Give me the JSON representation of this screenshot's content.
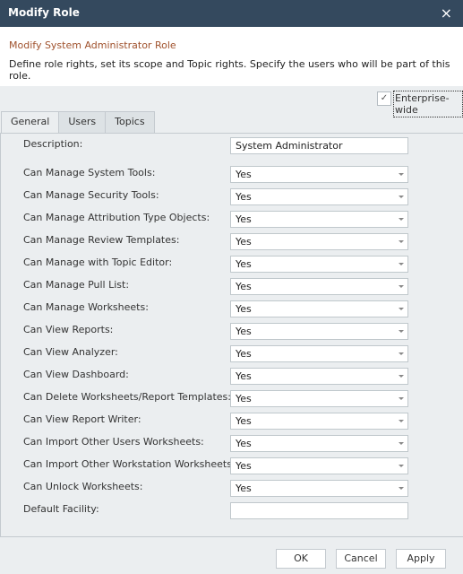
{
  "window": {
    "title": "Modify Role",
    "close_icon": "×"
  },
  "header": {
    "subtitle": "Modify System Administrator Role",
    "description": "Define role rights, set its scope and Topic rights. Specify the users who will be part of this role."
  },
  "enterprise_wide": {
    "label": "Enterprise-wide",
    "checked": true,
    "check_glyph": "✓"
  },
  "tabs": [
    {
      "label": "General",
      "active": true
    },
    {
      "label": "Users",
      "active": false
    },
    {
      "label": "Topics",
      "active": false
    }
  ],
  "form": {
    "description": {
      "label": "Description:",
      "value": "System Administrator"
    },
    "rights": [
      {
        "label": "Can Manage System Tools:",
        "value": "Yes"
      },
      {
        "label": "Can Manage Security Tools:",
        "value": "Yes"
      },
      {
        "label": "Can Manage Attribution Type Objects:",
        "value": "Yes"
      },
      {
        "label": "Can Manage Review Templates:",
        "value": "Yes"
      },
      {
        "label": "Can Manage with Topic Editor:",
        "value": "Yes"
      },
      {
        "label": "Can Manage Pull List:",
        "value": "Yes"
      },
      {
        "label": "Can Manage Worksheets:",
        "value": "Yes"
      },
      {
        "label": "Can View Reports:",
        "value": "Yes"
      },
      {
        "label": "Can View Analyzer:",
        "value": "Yes"
      },
      {
        "label": "Can View Dashboard:",
        "value": "Yes"
      },
      {
        "label": "Can Delete Worksheets/Report Templates:",
        "value": "Yes"
      },
      {
        "label": "Can View Report Writer:",
        "value": "Yes"
      },
      {
        "label": "Can Import Other Users Worksheets:",
        "value": "Yes"
      },
      {
        "label": "Can Import Other Workstation Worksheets:",
        "value": "Yes"
      },
      {
        "label": "Can Unlock Worksheets:",
        "value": "Yes"
      }
    ],
    "default_facility": {
      "label": "Default Facility:",
      "value": ""
    }
  },
  "buttons": {
    "ok": "OK",
    "cancel": "Cancel",
    "apply": "Apply"
  }
}
